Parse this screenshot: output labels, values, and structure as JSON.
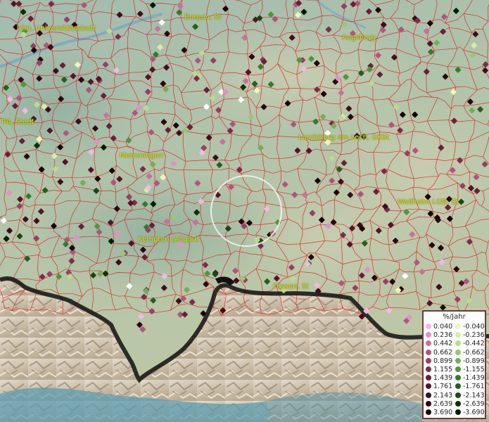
{
  "legend": {
    "title": "%/Jahr",
    "positive": [
      {
        "label": "0.040",
        "color": "#f2b8e6"
      },
      {
        "label": "0.236",
        "color": "#e48fc8"
      },
      {
        "label": "0.442",
        "color": "#c9709c"
      },
      {
        "label": "0.662",
        "color": "#b0557e"
      },
      {
        "label": "0.899",
        "color": "#983f63"
      },
      {
        "label": "1.155",
        "color": "#7e2c4a"
      },
      {
        "label": "1.439",
        "color": "#6b1f37"
      },
      {
        "label": "1.761",
        "color": "#561428"
      },
      {
        "label": "2.143",
        "color": "#420c1b"
      },
      {
        "label": "2.639",
        "color": "#2e0610"
      },
      {
        "label": "3.690",
        "color": "#1a0207"
      }
    ],
    "negative": [
      {
        "label": "-0.040",
        "color": "#f0f5b8"
      },
      {
        "label": "-0.236",
        "color": "#d9eba8"
      },
      {
        "label": "-0.442",
        "color": "#b9dc8e"
      },
      {
        "label": "-0.662",
        "color": "#96c873"
      },
      {
        "label": "-0.899",
        "color": "#71b055"
      },
      {
        "label": "-1.155",
        "color": "#4f963d"
      },
      {
        "label": "-1.439",
        "color": "#357c2a"
      },
      {
        "label": "-1.761",
        "color": "#21621b"
      },
      {
        "label": "-2.143",
        "color": "#144a10"
      },
      {
        "label": "-2.639",
        "color": "#0a3308"
      },
      {
        "label": "-3.690",
        "color": "#031c02"
      }
    ]
  },
  "cities": [
    {
      "name": "Burgau, St"
    },
    {
      "name": "Ulm, Universitätsstadt"
    },
    {
      "name": "Augsburg"
    },
    {
      "name": "Rit, Stadt"
    },
    {
      "name": "Landsberg am Lech, GKSt"
    },
    {
      "name": "Memmingen"
    },
    {
      "name": "Weilheim i.OB, St"
    },
    {
      "name": "Kempten (Allgäu)"
    },
    {
      "name": "Füssen, St"
    }
  ],
  "colors": {
    "boundary": "#e02020",
    "border": "#000000",
    "mountain": "#d9d0c0",
    "lake": "#6fa3c9"
  }
}
